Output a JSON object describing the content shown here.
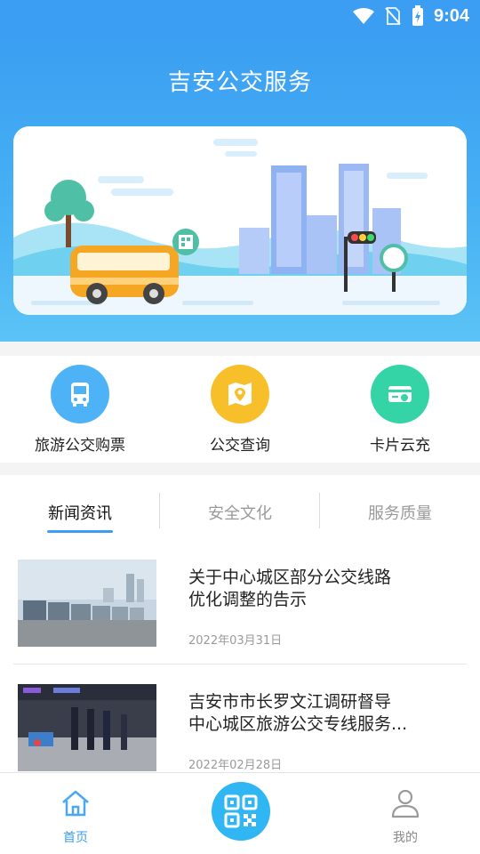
{
  "status_bar": {
    "time": "9:04"
  },
  "header": {
    "title": "吉安公交服务"
  },
  "quick_actions": [
    {
      "label": "旅游公交购票",
      "icon": "bus-icon",
      "color": "#4db3f6"
    },
    {
      "label": "公交查询",
      "icon": "map-pin-icon",
      "color": "#f7c02a"
    },
    {
      "label": "卡片云充",
      "icon": "card-recharge-icon",
      "color": "#35d4a7"
    }
  ],
  "news": {
    "tabs": [
      {
        "label": "新闻资讯",
        "active": true
      },
      {
        "label": "安全文化",
        "active": false
      },
      {
        "label": "服务质量",
        "active": false
      }
    ],
    "articles": [
      {
        "title_line1": "关于中心城区部分公交线路",
        "title_line2": "优化调整的告示",
        "date": "2022年03月31日"
      },
      {
        "title_line1": "吉安市市长罗文江调研督导",
        "title_line2": "中心城区旅游公交专线服务...",
        "date": "2022年02月28日"
      }
    ]
  },
  "bottom_nav": {
    "home_label": "首页",
    "mine_label": "我的",
    "accent": "#3b9ef2"
  }
}
